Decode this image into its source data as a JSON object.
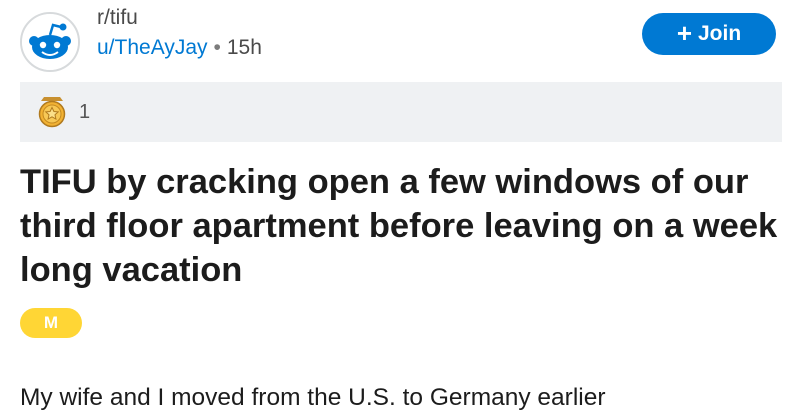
{
  "post": {
    "subreddit": "r/tifu",
    "author": "u/TheAyJay",
    "separator": "•",
    "age": "15h",
    "join_icon": "+",
    "join_label": "Join",
    "award_icon": "award-medal-icon",
    "award_count": "1",
    "title": "TIFU by cracking open a few windows of our third floor apartment before leaving on a week long vacation",
    "flair": "M",
    "body_first_line": "My wife and I moved from the U.S. to Germany earlier"
  },
  "colors": {
    "accent": "#0079d3",
    "flair": "#ffd635",
    "award_bar": "#eff1f3"
  }
}
